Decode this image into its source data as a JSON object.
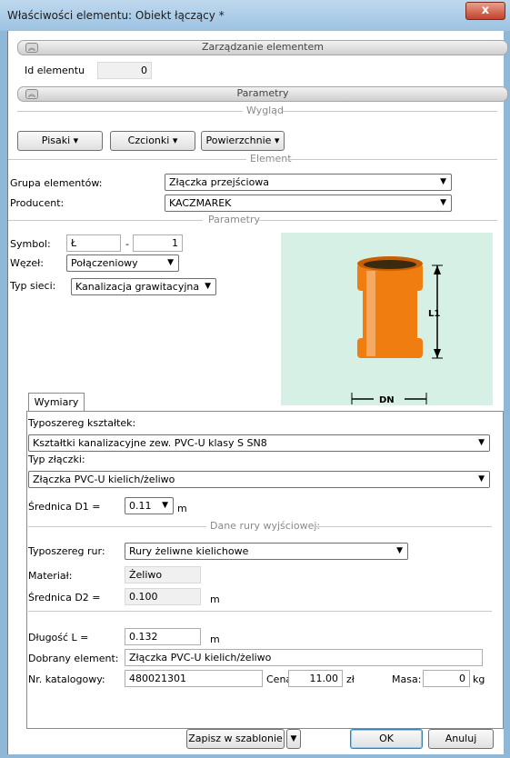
{
  "window": {
    "title": "Właściwości elementu: Obiekt łączący *",
    "close_label": "x"
  },
  "sections": {
    "management": "Zarządzanie elementem",
    "parameters": "Parametry",
    "appearance": "Wygląd",
    "element": "Element",
    "params_sub": "Parametry",
    "pipe_data": "Dane rury wyjściowej:"
  },
  "id_element": {
    "label": "Id elementu",
    "value": "0"
  },
  "appearance_buttons": {
    "pens": "Pisaki",
    "fonts": "Czcionki",
    "surfaces": "Powierzchnie"
  },
  "element": {
    "group_label": "Grupa elementów:",
    "group_value": "Złączka przejściowa",
    "producer_label": "Producent:",
    "producer_value": "KACZMAREK"
  },
  "params": {
    "symbol_label": "Symbol:",
    "symbol_prefix": "Ł",
    "symbol_sep": "-",
    "symbol_number": "1",
    "node_label": "Węzeł:",
    "node_value": "Połączeniowy",
    "network_label": "Typ sieci:",
    "network_value": "Kanalizacja grawitacyjna"
  },
  "figure": {
    "l1_label": "L1",
    "dn_label": "DN",
    "pipe_color": "#f07d10",
    "bg_color": "#d6f0e6"
  },
  "tabs": {
    "dimensions": "Wymiary"
  },
  "dimensions": {
    "series_label": "Typoszereg kształtek:",
    "series_value": "Kształtki kanalizacyjne zew. PVC-U klasy S SN8",
    "joint_label": "Typ złączki:",
    "joint_value": "Złączka PVC-U kielich/żeliwo",
    "d1_label": "Średnica D1 =",
    "d1_value": "0.11",
    "d1_unit": "m",
    "pipe_series_label": "Typoszereg rur:",
    "pipe_series_value": "Rury żeliwne kielichowe",
    "material_label": "Materiał:",
    "material_value": "Żeliwo",
    "d2_label": "Średnica D2 =",
    "d2_value": "0.100",
    "d2_unit": "m",
    "length_label": "Długość L =",
    "length_value": "0.132",
    "length_unit": "m",
    "chosen_label": "Dobrany element:",
    "chosen_value": "Złączka PVC-U kielich/żeliwo",
    "catalog_label": "Nr. katalogowy:",
    "catalog_value": "480021301",
    "price_label": "Cena:",
    "price_value": "11.00",
    "price_unit": "zł",
    "mass_label": "Masa:",
    "mass_value": "0",
    "mass_unit": "kg"
  },
  "footer": {
    "save_template": "Zapisz w szablonie",
    "ok": "OK",
    "cancel": "Anuluj"
  }
}
